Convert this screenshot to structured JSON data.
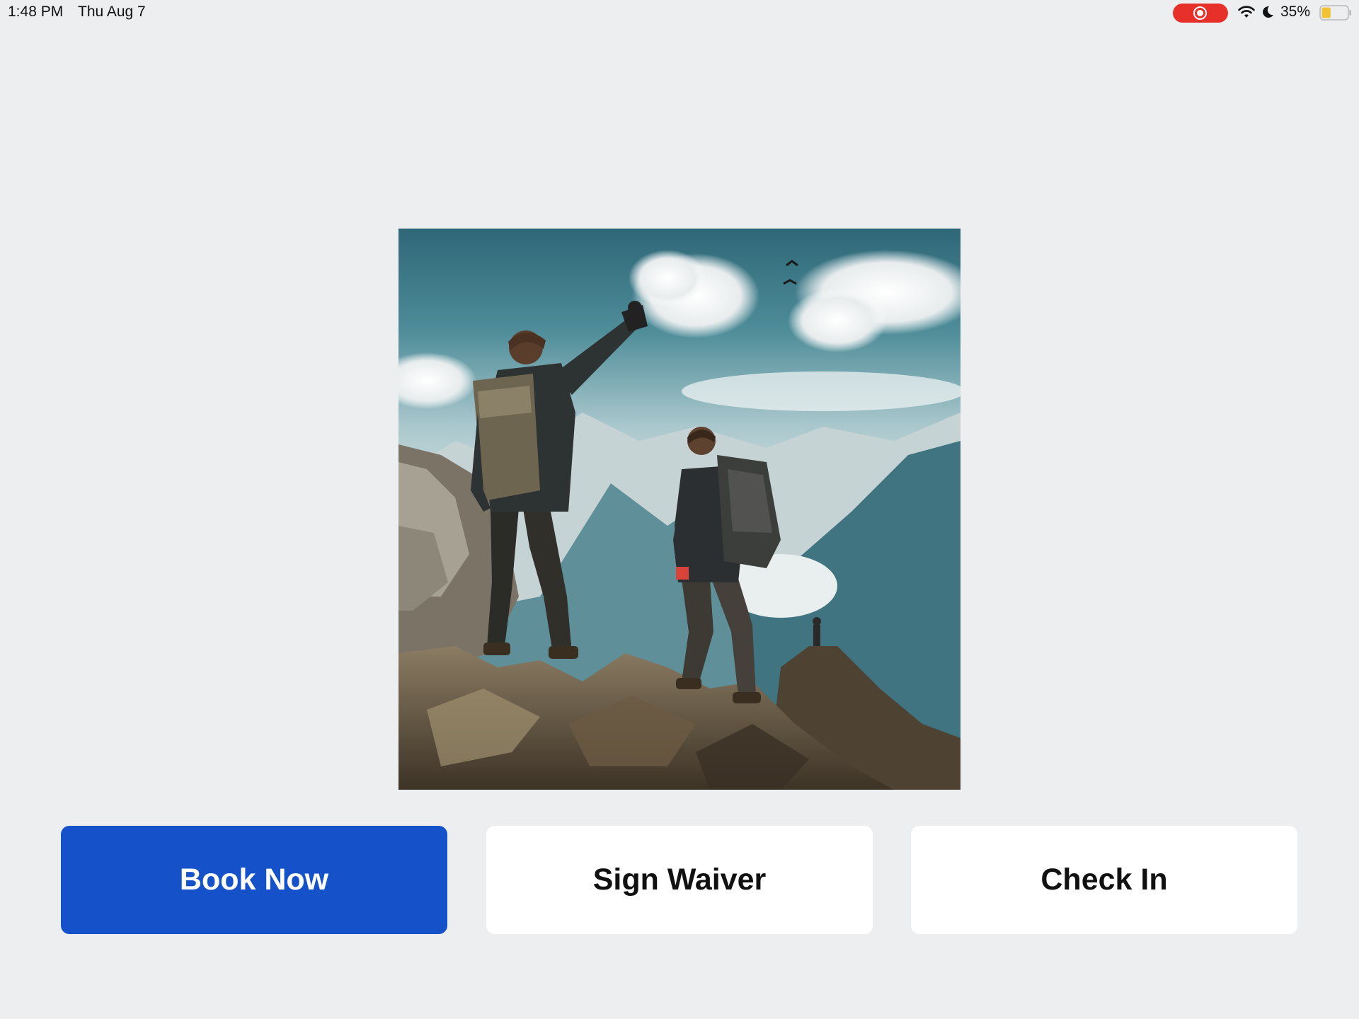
{
  "status_bar": {
    "time": "1:48 PM",
    "date": "Thu Aug 7",
    "battery_percent": "35%",
    "battery_level": 0.35,
    "icons": [
      "screen-recording-icon",
      "wifi-icon",
      "do-not-disturb-moon-icon",
      "battery-icon"
    ],
    "recording_color": "#e8302a"
  },
  "hero_image": {
    "icon": "mountain-hikers-photo"
  },
  "actions": {
    "book_now": "Book Now",
    "sign_waiver": "Sign Waiver",
    "check_in": "Check In"
  },
  "colors": {
    "background": "#edeef0",
    "primary": "#1552c9",
    "secondary_button": "#ffffff"
  }
}
